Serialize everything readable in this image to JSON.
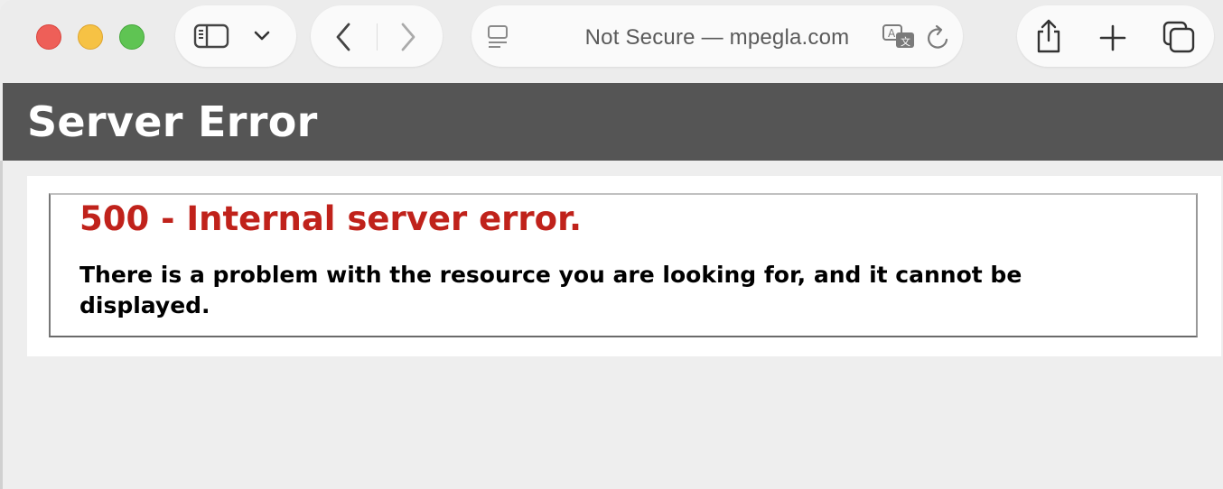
{
  "browser": {
    "address_bar": {
      "security_label": "Not Secure",
      "separator": "—",
      "domain": "mpegla.com",
      "display": "Not Secure — mpegla.com"
    },
    "icons": {
      "sidebar": "sidebar-icon",
      "sidebar_menu": "chevron-down-icon",
      "back": "chevron-left-icon",
      "forward": "chevron-right-icon",
      "page_menu": "page-menu-icon",
      "translate": "translate-icon",
      "reload": "reload-icon",
      "share": "share-icon",
      "new_tab": "plus-icon",
      "tabs_overview": "tabs-overview-icon"
    },
    "traffic_lights": {
      "close_color": "#ee5f58",
      "minimize_color": "#f6c244",
      "maximize_color": "#5fc453"
    }
  },
  "page": {
    "header_title": "Server Error",
    "error_title": "500 - Internal server error.",
    "error_description": "There is a problem with the resource you are looking for, and it cannot be displayed.",
    "colors": {
      "header_bg": "#555555",
      "error_title": "#c0221b",
      "page_bg": "#eeeeee"
    }
  }
}
